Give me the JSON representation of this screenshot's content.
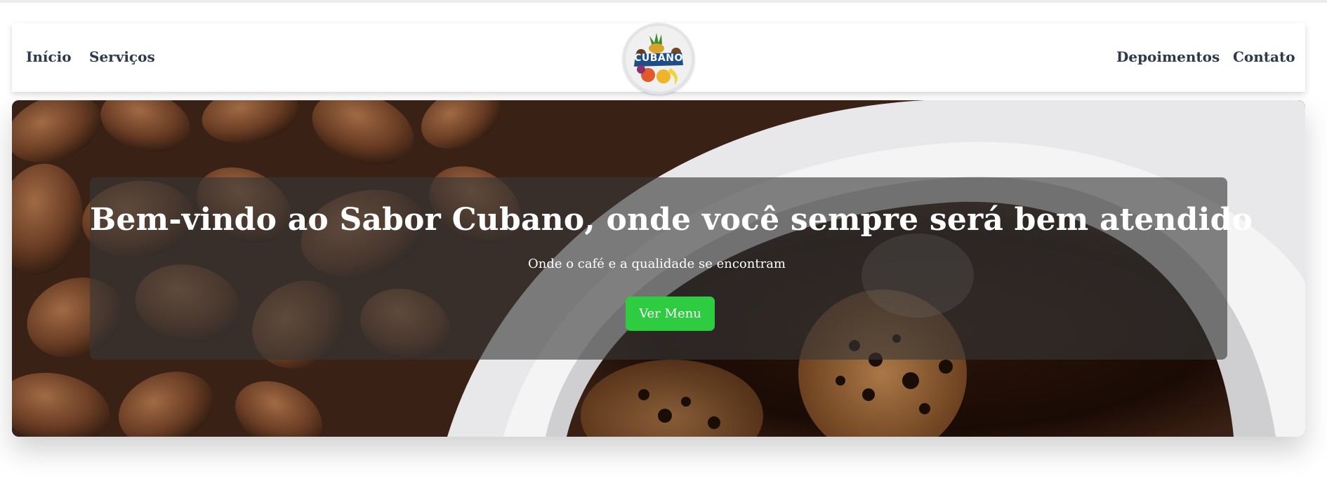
{
  "nav": {
    "left_links": [
      "Início",
      "Serviços"
    ],
    "right_links": [
      "Depoimentos",
      "Contato"
    ],
    "logo": {
      "text": "CUBANO",
      "icon": "fruit-logo"
    }
  },
  "hero": {
    "title": "Bem-vindo ao Sabor Cubano, onde você sempre será bem atendido",
    "subtitle": "Onde o café e a qualidade se encontram",
    "button_label": "Ver Menu",
    "button_color": "#2ecc40",
    "background_image": "coffee-beans-and-cup-photo"
  },
  "colors": {
    "nav_text": "#2d3a4e",
    "overlay": "rgba(55,55,55,0.62)"
  }
}
